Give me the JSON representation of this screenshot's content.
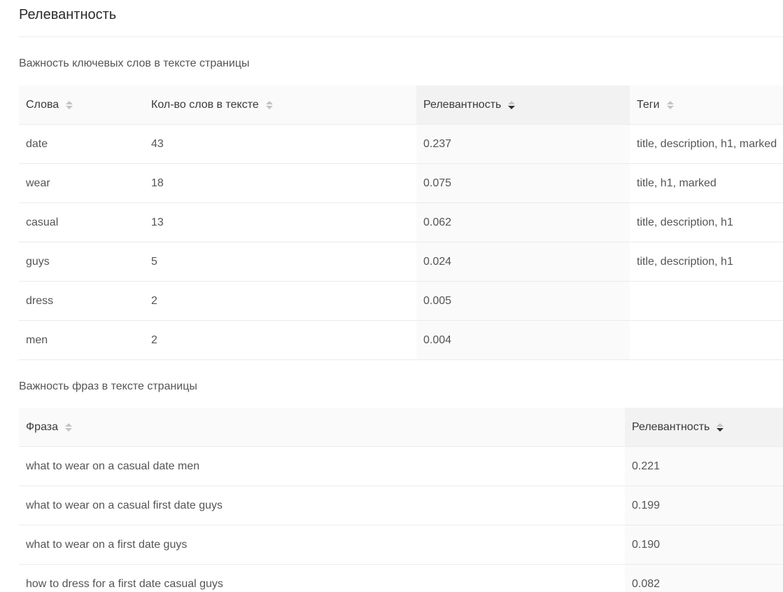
{
  "page": {
    "title": "Релевантность"
  },
  "keywords_section": {
    "title": "Важность ключевых слов в тексте страницы",
    "columns": [
      "Слова",
      "Кол-во слов в тексте",
      "Релевантность",
      "Теги"
    ],
    "sorted_column": "Релевантность",
    "sort_direction": "desc",
    "rows": [
      {
        "word": "date",
        "count": "43",
        "relevance": "0.237",
        "tags": "title, description, h1, marked"
      },
      {
        "word": "wear",
        "count": "18",
        "relevance": "0.075",
        "tags": "title, h1, marked"
      },
      {
        "word": "casual",
        "count": "13",
        "relevance": "0.062",
        "tags": "title, description, h1"
      },
      {
        "word": "guys",
        "count": "5",
        "relevance": "0.024",
        "tags": "title, description, h1"
      },
      {
        "word": "dress",
        "count": "2",
        "relevance": "0.005",
        "tags": ""
      },
      {
        "word": "men",
        "count": "2",
        "relevance": "0.004",
        "tags": ""
      }
    ]
  },
  "phrases_section": {
    "title": "Важность фраз в тексте страницы",
    "columns": [
      "Фраза",
      "Релевантность"
    ],
    "sorted_column": "Релевантность",
    "sort_direction": "desc",
    "rows": [
      {
        "phrase": "what to wear on a casual date men",
        "relevance": "0.221"
      },
      {
        "phrase": "what to wear on a casual first date guys",
        "relevance": "0.199"
      },
      {
        "phrase": "what to wear on a first date guys",
        "relevance": "0.190"
      },
      {
        "phrase": "how to dress for a first date casual guys",
        "relevance": "0.082"
      }
    ]
  },
  "colors": {
    "header_bg": "#fafafa",
    "sorted_header_bg": "#f2f2f2",
    "sorted_cell_bg": "#fafafa",
    "border": "#ebebeb",
    "text": "#555555",
    "sort_icon_inactive": "#c4c4c4",
    "sort_icon_active": "#333333"
  },
  "icons": {
    "sort": "sort-caret-icon"
  }
}
